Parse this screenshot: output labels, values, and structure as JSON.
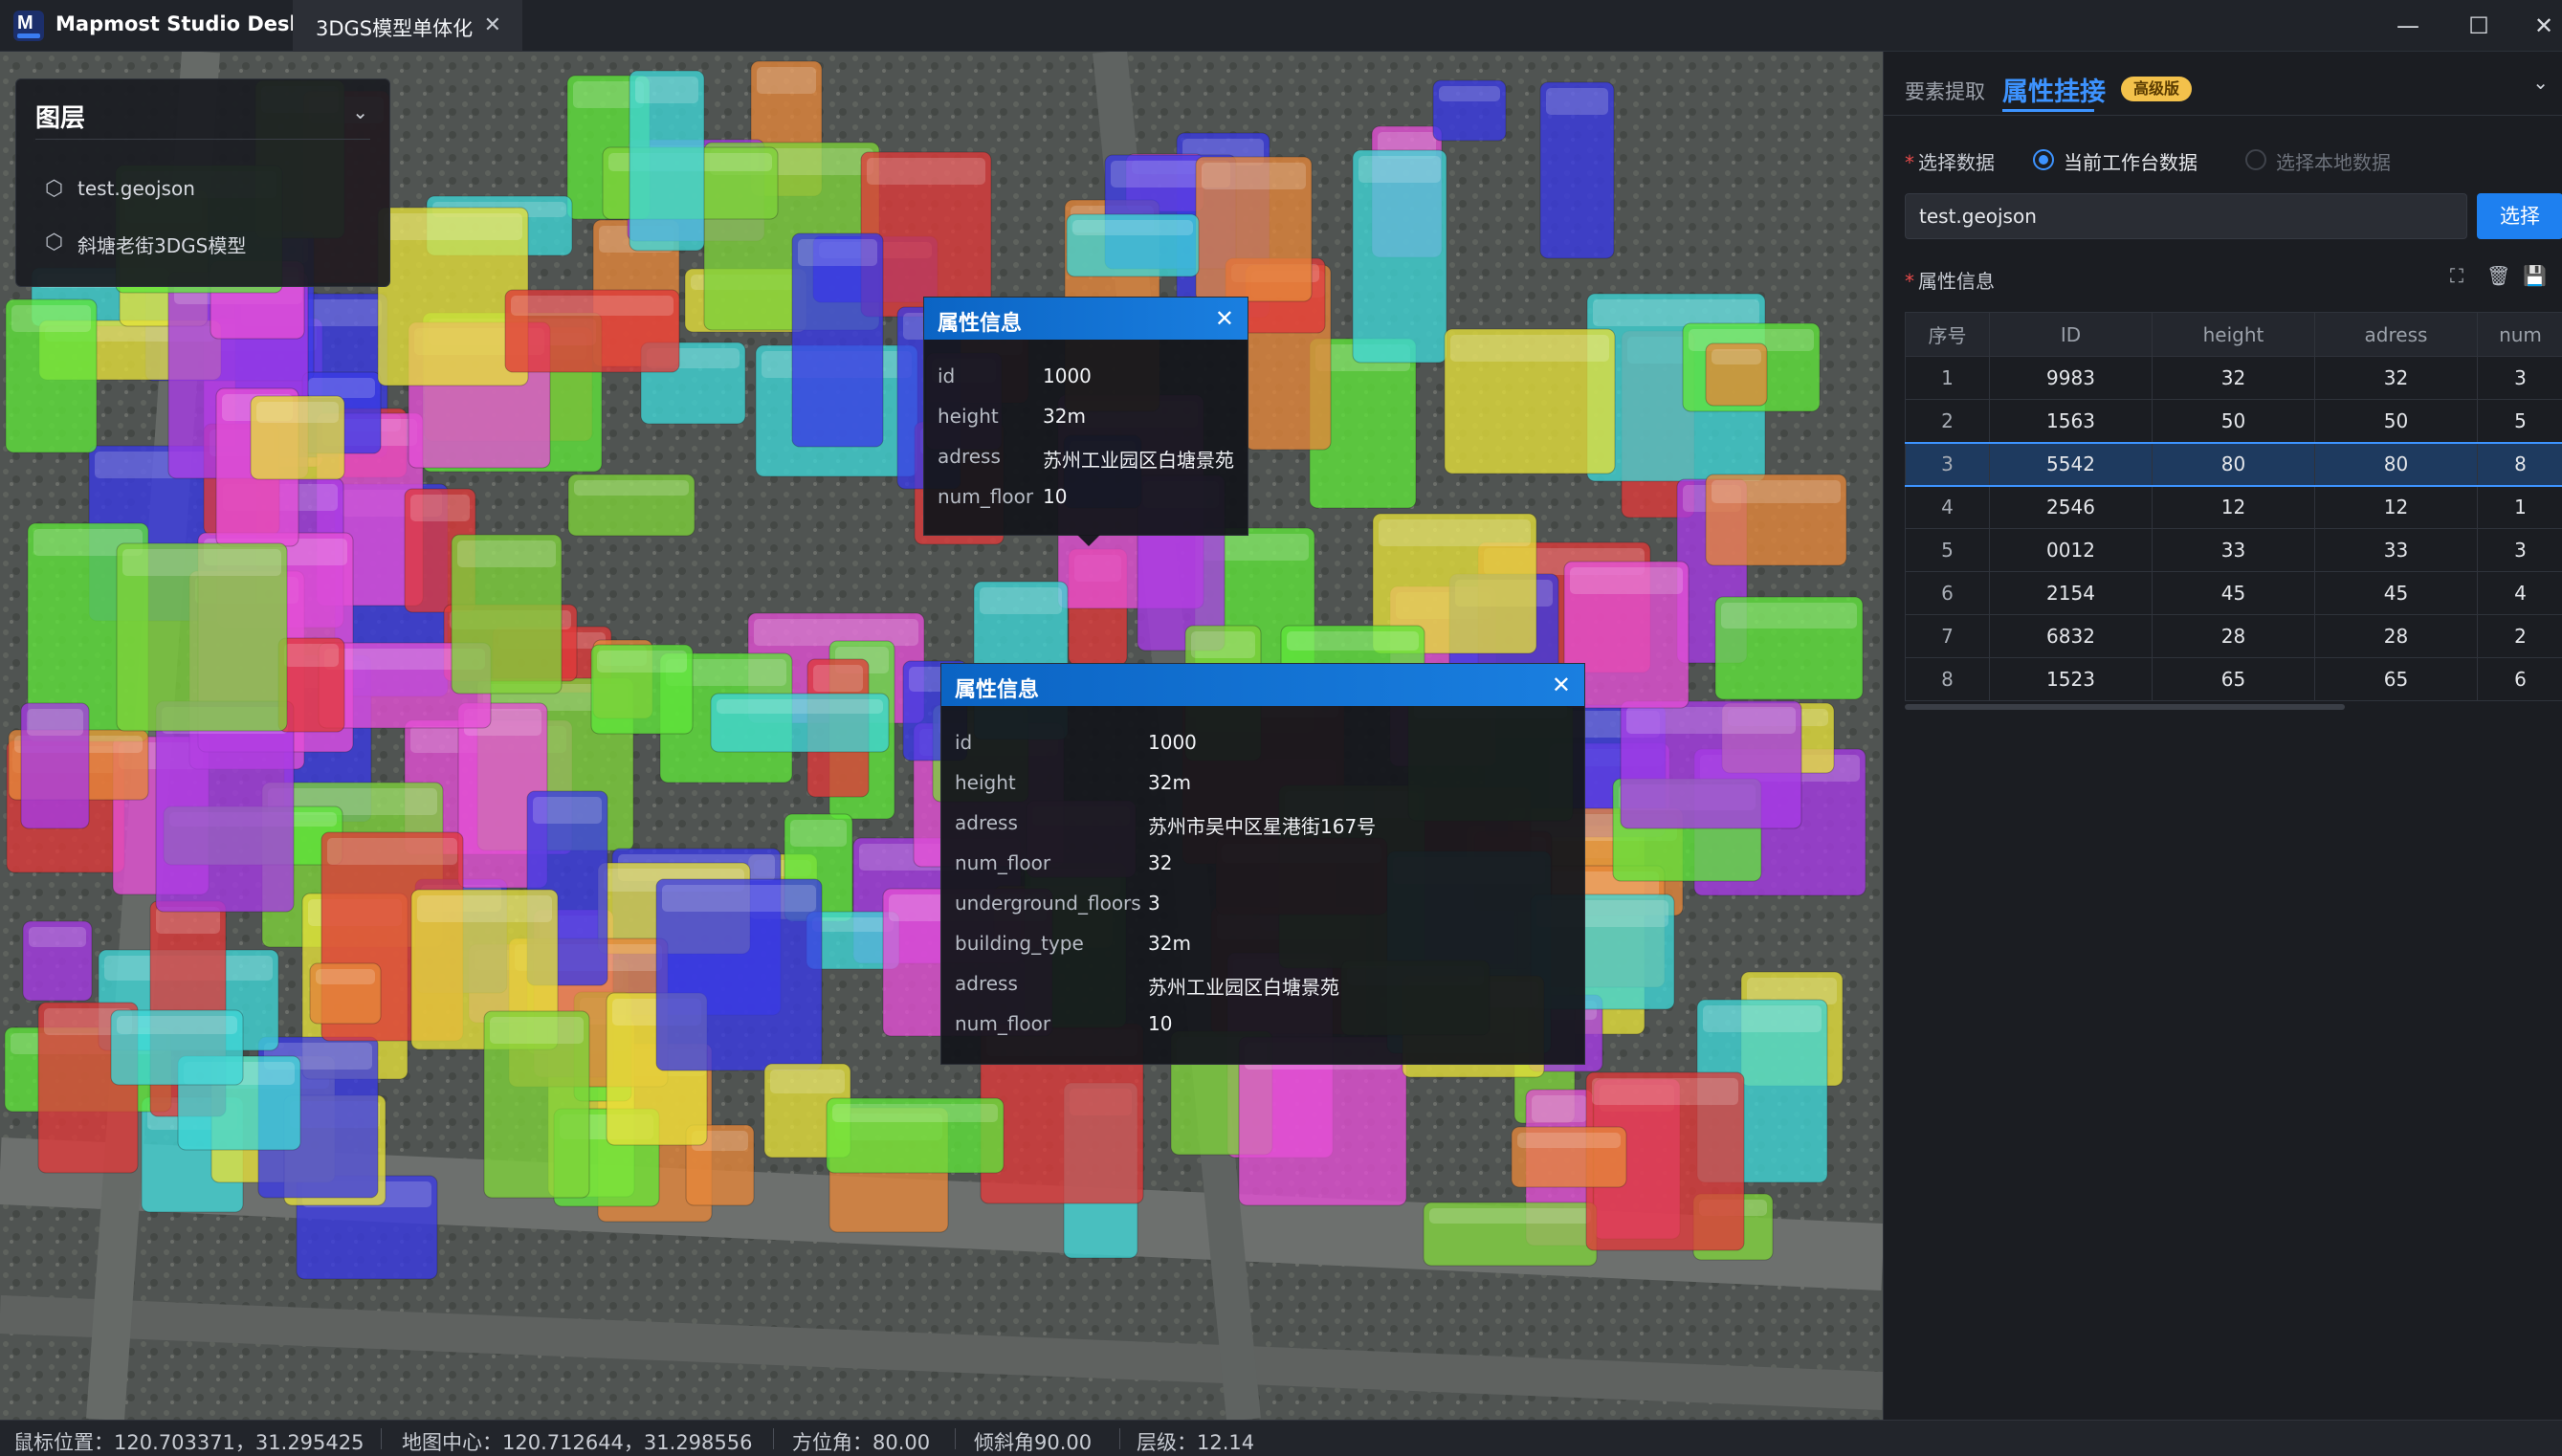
{
  "titlebar": {
    "app_name": "Mapmost Studio Desktop",
    "doc_tab": "3DGS模型单体化",
    "close_glyph": "✕",
    "minimize_glyph": "—",
    "maximize_glyph": "☐",
    "window_close_glyph": "✕"
  },
  "layer_panel": {
    "title": "图层",
    "items": [
      {
        "label": "test.geojson",
        "icon": "cube-icon"
      },
      {
        "label": "斜塘老街3DGS模型",
        "icon": "cube-icon"
      }
    ]
  },
  "popup_small": {
    "title": "属性信息",
    "rows": [
      {
        "key": "id",
        "value": "1000"
      },
      {
        "key": "height",
        "value": "32m"
      },
      {
        "key": "adress",
        "value": "苏州工业园区白塘景苑"
      },
      {
        "key": "num_floor",
        "value": "10"
      }
    ]
  },
  "popup_large": {
    "title": "属性信息",
    "rows": [
      {
        "key": "id",
        "value": "1000"
      },
      {
        "key": "height",
        "value": "32m"
      },
      {
        "key": "adress",
        "value": "苏州市吴中区星港街167号"
      },
      {
        "key": "num_floor",
        "value": "32"
      },
      {
        "key": "underground_floors",
        "value": "3"
      },
      {
        "key": "building_type",
        "value": "32m"
      },
      {
        "key": "adress",
        "value": "苏州工业园区白塘景苑"
      },
      {
        "key": "num_floor",
        "value": "10"
      }
    ]
  },
  "statusbar": {
    "mouse": "鼠标位置：120.703371，31.295425",
    "center": "地图中心：120.712644，31.298556",
    "azimuth": "方位角：80.00",
    "pitch": "倾斜角90.00",
    "level": "层级：12.14"
  },
  "right_panel": {
    "tab_extract": "要素提取",
    "tab_attach": "属性挂接",
    "badge": "高级版",
    "select_data_label": "选择数据",
    "radio_workspace": "当前工作台数据",
    "radio_local": "选择本地数据",
    "file_value": "test.geojson",
    "select_button": "选择",
    "attr_label": "属性信息",
    "columns": [
      "序号",
      "ID",
      "height",
      "adress",
      "num"
    ],
    "rows": [
      [
        "1",
        "9983",
        "32",
        "32",
        "3"
      ],
      [
        "2",
        "1563",
        "50",
        "50",
        "5"
      ],
      [
        "3",
        "5542",
        "80",
        "80",
        "8"
      ],
      [
        "4",
        "2546",
        "12",
        "12",
        "1"
      ],
      [
        "5",
        "0012",
        "33",
        "33",
        "3"
      ],
      [
        "6",
        "2154",
        "45",
        "45",
        "4"
      ],
      [
        "7",
        "6832",
        "28",
        "28",
        "2"
      ],
      [
        "8",
        "1523",
        "65",
        "65",
        "6"
      ]
    ],
    "selected_row": 3
  },
  "colors": {
    "accent": "#3d93ff",
    "popup_header": "#1a7fe0",
    "badge": "#f3c14b",
    "building_palette": [
      "#e03a3a",
      "#7ed23a",
      "#3fd6d6",
      "#e64fd6",
      "#3a3ae6",
      "#e6e03a",
      "#e6873a",
      "#a63ae6",
      "#5fe63a"
    ]
  }
}
